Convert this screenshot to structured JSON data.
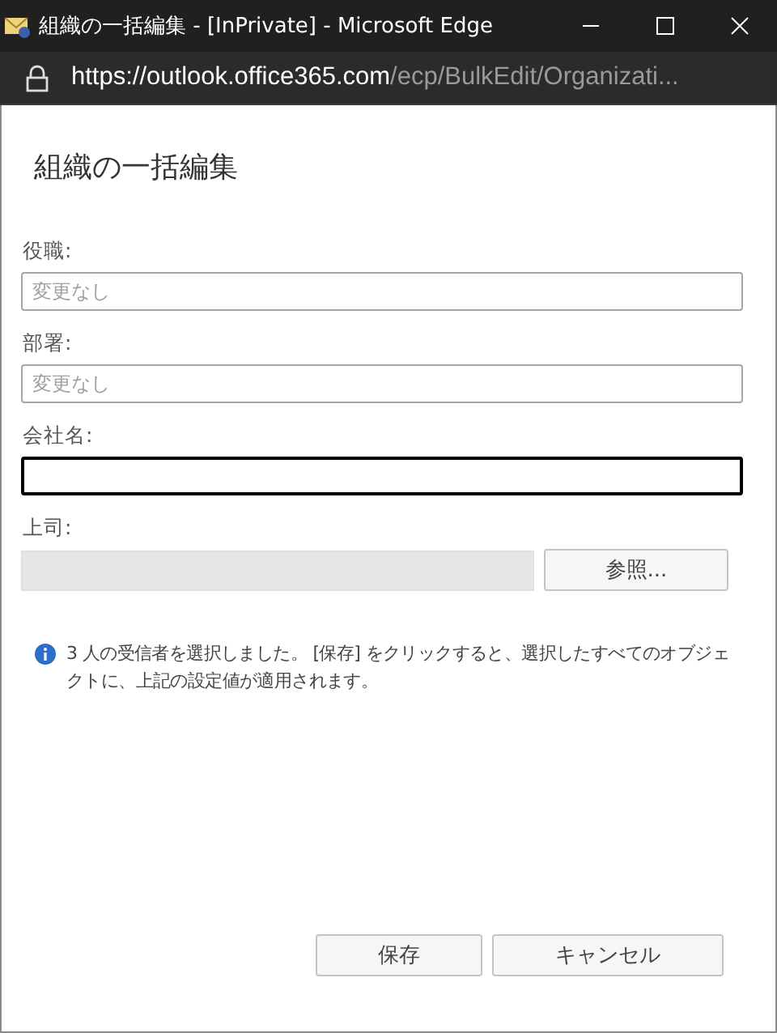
{
  "window": {
    "title": "組織の一括編集 - [InPrivate] - Microsoft Edge"
  },
  "address_bar": {
    "url_host": "https://outlook.office365.com",
    "url_path": "/ecp/BulkEdit/Organizati..."
  },
  "dialog": {
    "heading": "組織の一括編集",
    "fields": [
      {
        "kind": "text",
        "label": "役職:",
        "placeholder": "変更なし",
        "focused": false
      },
      {
        "kind": "text",
        "label": "部署:",
        "placeholder": "変更なし",
        "focused": false
      },
      {
        "kind": "text",
        "label": "会社名:",
        "focused": true
      },
      {
        "kind": "picker",
        "label": "上司:",
        "disabled": true,
        "button": "参照..."
      }
    ],
    "info": "3 人の受信者を選択しました。 [保存] をクリックすると、選択したすべてのオブジェクトに、上記の設定値が適用されます。",
    "buttons": [
      "保存",
      "キャンセル"
    ]
  }
}
